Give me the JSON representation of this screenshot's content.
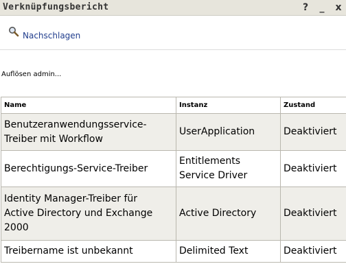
{
  "window": {
    "title": "Verknüpfungsbericht",
    "help_icon": "?",
    "minimize_icon": "_",
    "close_icon": "x"
  },
  "toolbar": {
    "lookup_label": "Nachschlagen",
    "lookup_icon": "magnifier-icon"
  },
  "status_text": "Auflösen admin...",
  "table": {
    "headers": [
      "Name",
      "Instanz",
      "Zustand"
    ],
    "rows": [
      {
        "name": [
          "Benutzeranwendungsservice-",
          "Treiber mit Workflow"
        ],
        "instance": [
          "UserApplication"
        ],
        "state": "Deaktiviert"
      },
      {
        "name": [
          "Berechtigungs-Service-Treiber"
        ],
        "instance": [
          "Entitlements",
          "Service Driver"
        ],
        "state": "Deaktiviert"
      },
      {
        "name": [
          "Identity Manager-Treiber für",
          "Active Directory und Exchange",
          "2000"
        ],
        "instance": [
          "Active Directory"
        ],
        "state": "Deaktiviert"
      },
      {
        "name": [
          "Treibername ist unbekannt"
        ],
        "instance": [
          "Delimited Text"
        ],
        "state": "Deaktiviert"
      }
    ]
  }
}
